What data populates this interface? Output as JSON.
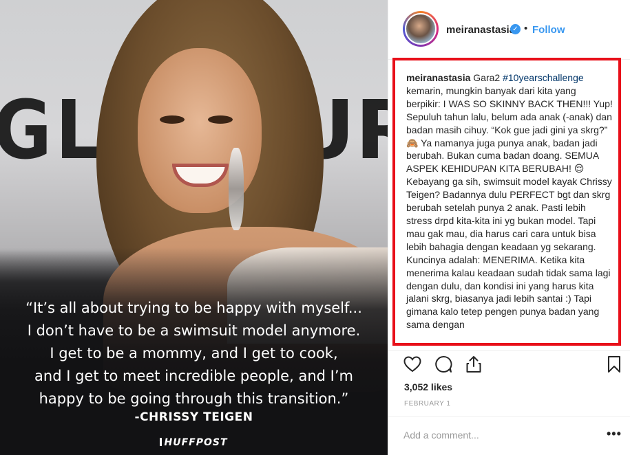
{
  "photo": {
    "backdrop_left": "GLA",
    "backdrop_right": "UR",
    "quote_lines": [
      "“It’s all about trying to be happy with myself...",
      "I don’t have to be a swimsuit model anymore.",
      "I get to be a mommy, and I get to cook,",
      "and I get to meet incredible people, and I’m",
      "happy to be going through this transition.”"
    ],
    "author": "-CHRISSY TEIGEN",
    "brand": "HUFFPOST"
  },
  "header": {
    "username": "meiranastasia",
    "verified_icon": "verified-check",
    "separator": "•",
    "follow_label": "Follow"
  },
  "caption": {
    "username": "meiranastasia",
    "intro": " Gara2 ",
    "hashtag": "#10yearschallenge",
    "body": " kemarin, mungkin banyak dari kita yang berpikir: I WAS SO SKINNY BACK THEN!!! Yup! Sepuluh tahun lalu, belum ada anak (-anak) dan badan masih cihuy. “Kok gue jadi gini ya skrg?” 🙈 Ya namanya juga punya anak, badan jadi berubah. Bukan cuma badan doang. SEMUA ASPEK KEHIDUPAN KITA BERUBAH! 😌 Kebayang ga sih, swimsuit model kayak Chrissy Teigen? Badannya dulu PERFECT bgt dan skrg berubah setelah punya 2 anak. Pasti lebih stress drpd kita-kita ini yg bukan model. Tapi mau gak mau, dia harus cari cara untuk bisa lebih bahagia dengan keadaan yg sekarang. Kuncinya adalah: MENERIMA. Ketika kita menerima kalau keadaan sudah tidak sama lagi dengan dulu, dan kondisi ini yang harus kita jalani skrg, biasanya jadi lebih santai :) Tapi gimana kalo tetep pengen punya badan yang sama dengan"
  },
  "actions": {
    "like_icon": "heart-icon",
    "comment_icon": "comment-icon",
    "share_icon": "share-icon",
    "save_icon": "bookmark-icon"
  },
  "likes": "3,052 likes",
  "date": "FEBRUARY 1",
  "comment": {
    "placeholder": "Add a comment...",
    "more_label": "•••"
  },
  "colors": {
    "highlight_border": "#e8101a",
    "link_blue": "#3897f0",
    "hashtag": "#003569"
  }
}
